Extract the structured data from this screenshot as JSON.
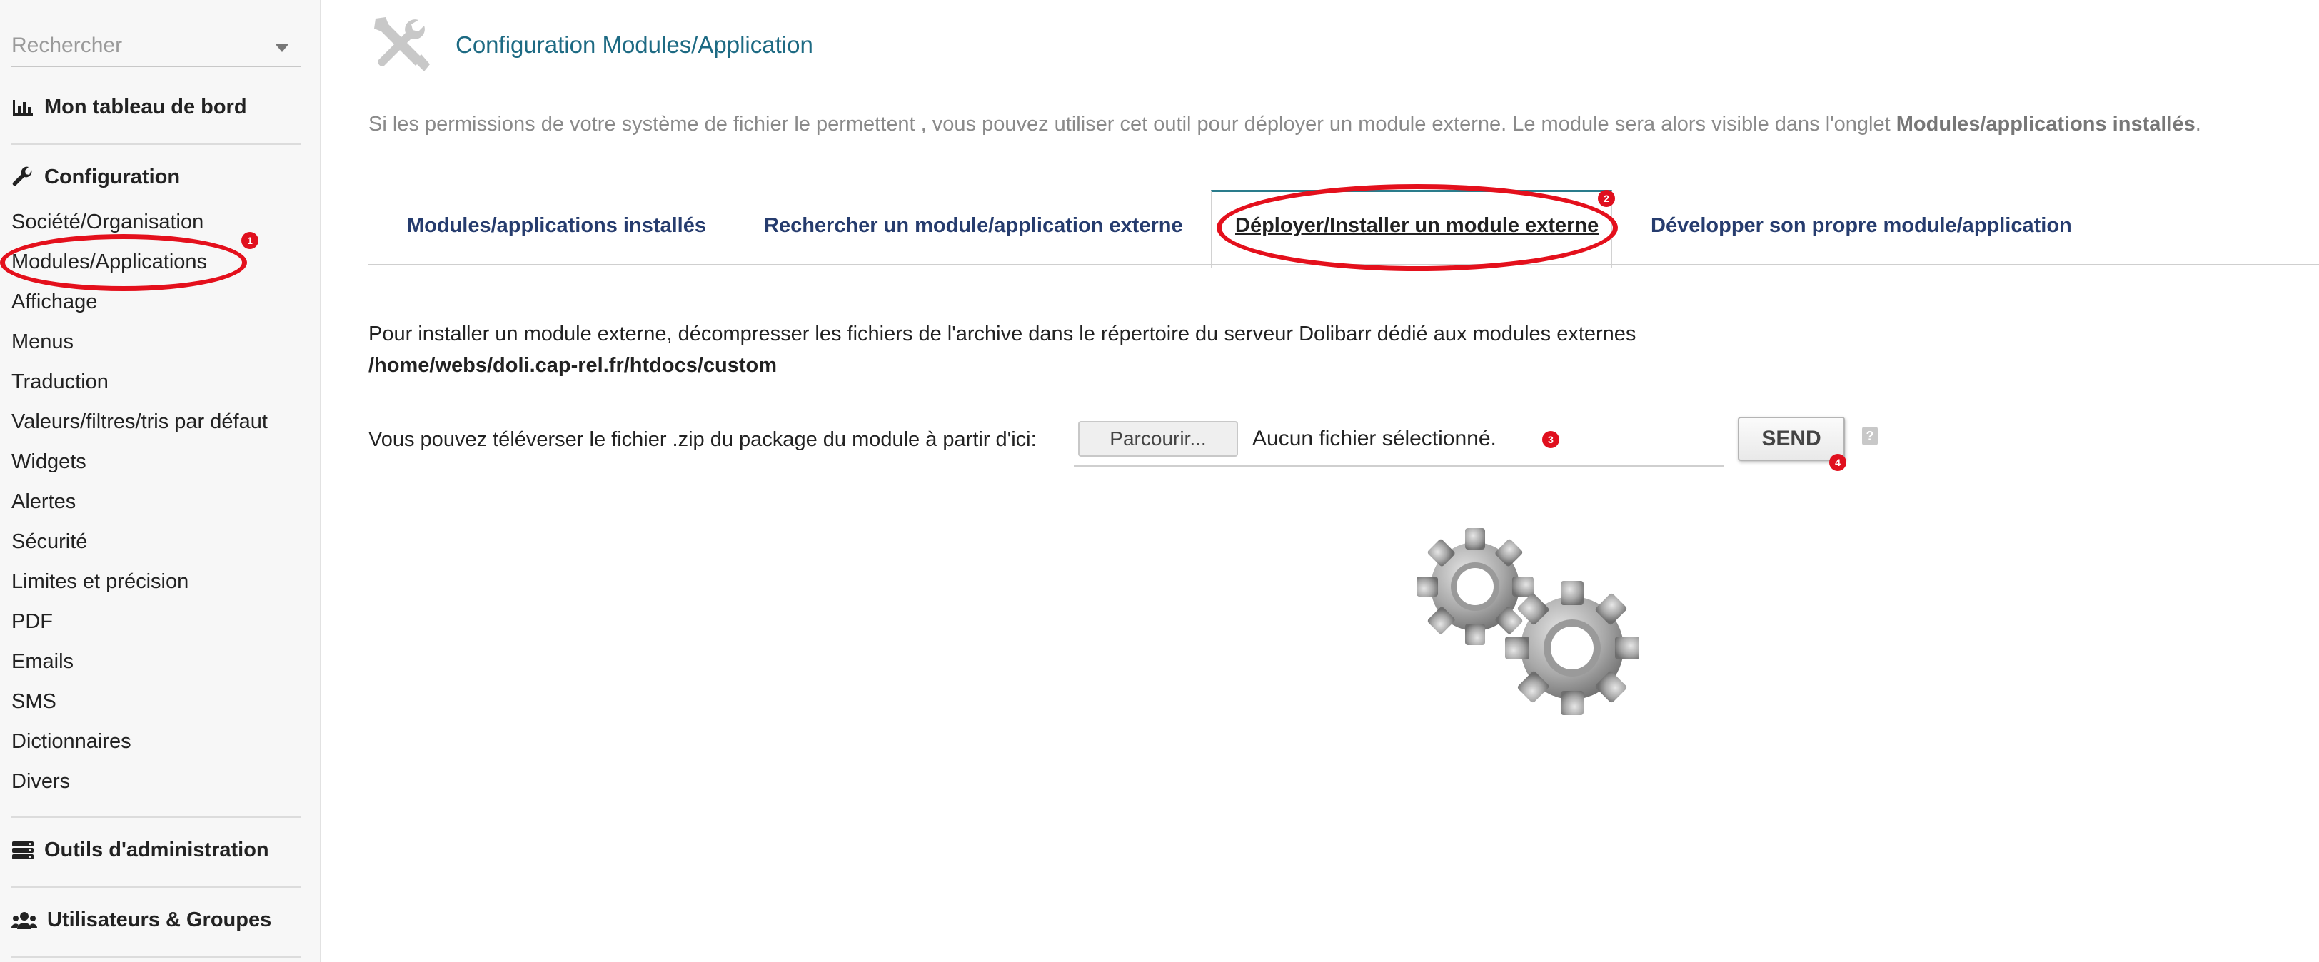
{
  "sidebar": {
    "search_placeholder": "Rechercher",
    "dashboard": "Mon tableau de bord",
    "configuration": "Configuration",
    "config_items": [
      "Société/Organisation",
      "Modules/Applications",
      "Affichage",
      "Menus",
      "Traduction",
      "Valeurs/filtres/tris par défaut",
      "Widgets",
      "Alertes",
      "Sécurité",
      "Limites et précision",
      "PDF",
      "Emails",
      "SMS",
      "Dictionnaires",
      "Divers"
    ],
    "admin_tools": "Outils d'administration",
    "users_groups": "Utilisateurs & Groupes"
  },
  "header": {
    "title": "Configuration Modules/Application",
    "intro": "Si les permissions de votre système de fichier le permettent , vous pouvez utiliser cet outil pour déployer un module externe. Le module sera alors visible dans l'onglet ",
    "intro_bold": "Modules/applications installés",
    "intro_end": "."
  },
  "tabs": [
    "Modules/applications installés",
    "Rechercher un module/application externe",
    "Déployer/Installer un module externe",
    "Développer son propre module/application"
  ],
  "deploy": {
    "description": "Pour installer un module externe, décompresser les fichiers de l'archive dans le répertoire du serveur Dolibarr dédié aux modules externes",
    "path": "/home/webs/doli.cap-rel.fr/htdocs/custom",
    "upload_label": "Vous pouvez téléverser le fichier .zip du package du module à partir d'ici:",
    "browse_label": "Parcourir...",
    "file_status": "Aucun fichier sélectionné.",
    "send_label": "SEND",
    "help_glyph": "?"
  },
  "annotations": {
    "markers": [
      "1",
      "2",
      "3",
      "4"
    ],
    "highlight_color": "#e4101c"
  },
  "icons": {
    "title": "tools-icon",
    "dashboard": "bar-chart-icon",
    "configuration": "wrench-icon",
    "admin_tools": "server-icon",
    "users_groups": "users-icon",
    "illustration": "gears-icon"
  }
}
